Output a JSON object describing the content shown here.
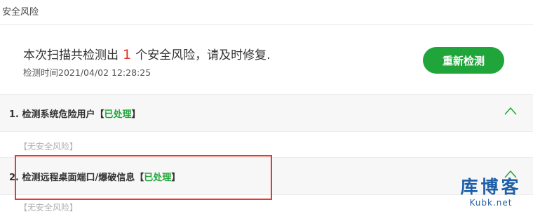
{
  "header": {
    "title": "安全风险"
  },
  "summary": {
    "text_before": "本次扫描共检测出",
    "risk_count": "1",
    "text_after": "个安全风险，请及时修复.",
    "detect_time": "检测时间2021/04/02 12:28:25",
    "recheck_label": "重新检测"
  },
  "sections": [
    {
      "label": "1. 检测系统危险用户【",
      "status": "已处理",
      "close": "】",
      "note": "【无安全风险】",
      "expanded": true
    },
    {
      "label": "2. 检测远程桌面端口/爆破信息【",
      "status": "已处理",
      "close": "】",
      "note": "【无安全风险】",
      "expanded": true
    }
  ],
  "watermark": {
    "title": "库博客",
    "subtitle": "Kubk.net"
  },
  "colors": {
    "accent_green": "#20a53a",
    "risk_red": "#e0301e",
    "highlight_red": "#e53935",
    "watermark_blue": "#1f5fa8"
  }
}
